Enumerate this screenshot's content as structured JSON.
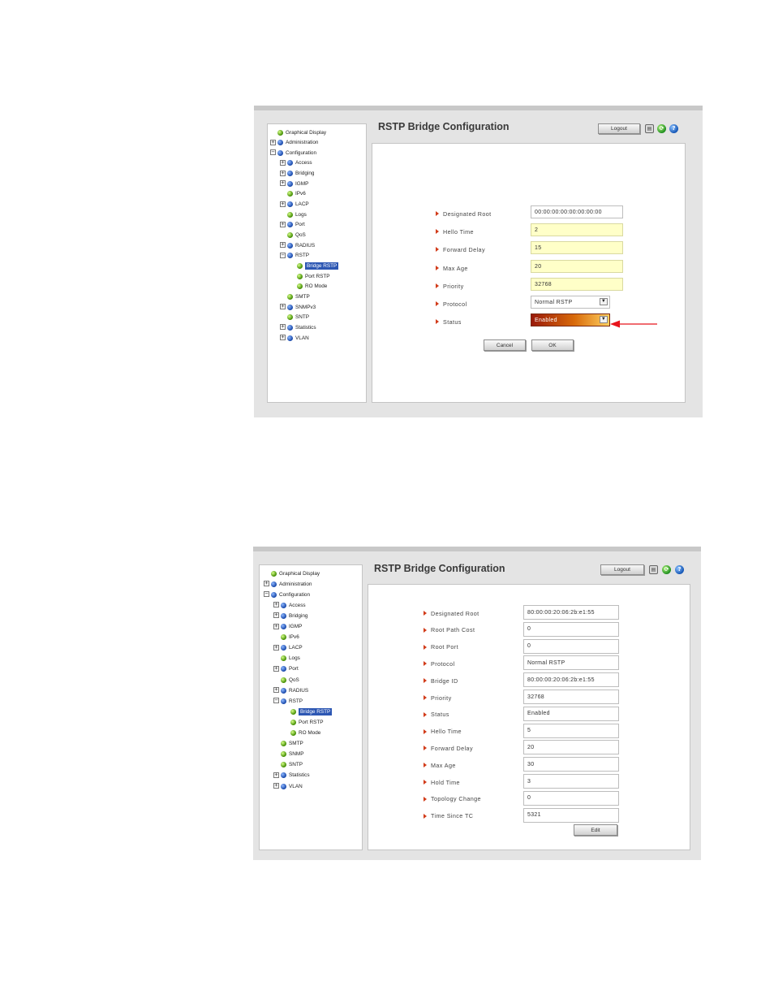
{
  "screen1": {
    "title": "RSTP Bridge Configuration",
    "logout_label": "Logout",
    "nav": [
      {
        "label": "Graphical Display",
        "icon": "green",
        "expander": ""
      },
      {
        "label": "Administration",
        "icon": "blue",
        "expander": "+"
      },
      {
        "label": "Configuration",
        "icon": "blue",
        "expander": "−"
      },
      {
        "label": "Access",
        "icon": "blue",
        "expander": "+"
      },
      {
        "label": "Bridging",
        "icon": "blue",
        "expander": "+"
      },
      {
        "label": "IGMP",
        "icon": "blue",
        "expander": "+"
      },
      {
        "label": "IPv6",
        "icon": "green",
        "expander": ""
      },
      {
        "label": "LACP",
        "icon": "blue",
        "expander": "+"
      },
      {
        "label": "Logs",
        "icon": "green",
        "expander": ""
      },
      {
        "label": "Port",
        "icon": "blue",
        "expander": "+"
      },
      {
        "label": "QoS",
        "icon": "green",
        "expander": ""
      },
      {
        "label": "RADIUS",
        "icon": "blue",
        "expander": "+"
      },
      {
        "label": "RSTP",
        "icon": "blue",
        "expander": "−"
      },
      {
        "label": "Bridge RSTP",
        "icon": "green",
        "expander": "",
        "selected": true
      },
      {
        "label": "Port RSTP",
        "icon": "green",
        "expander": ""
      },
      {
        "label": "RO Mode",
        "icon": "green",
        "expander": ""
      },
      {
        "label": "SMTP",
        "icon": "green",
        "expander": ""
      },
      {
        "label": "SNMPv3",
        "icon": "blue",
        "expander": "+"
      },
      {
        "label": "SNTP",
        "icon": "green",
        "expander": ""
      },
      {
        "label": "Statistics",
        "icon": "blue",
        "expander": "+"
      },
      {
        "label": "VLAN",
        "icon": "blue",
        "expander": "+"
      }
    ],
    "fields": [
      {
        "label": "Designated Root",
        "value": "00:00:00:00:00:00:00:00",
        "style": "plain"
      },
      {
        "label": "Hello Time",
        "value": "2",
        "style": "yellow"
      },
      {
        "label": "Forward Delay",
        "value": "15",
        "style": "yellow"
      },
      {
        "label": "Max Age",
        "value": "20",
        "style": "yellow"
      },
      {
        "label": "Priority",
        "value": "32768",
        "style": "yellow"
      },
      {
        "label": "Protocol",
        "value": "Normal RSTP",
        "style": "select"
      },
      {
        "label": "Status",
        "value": "Enabled",
        "style": "select enabled"
      }
    ],
    "cancel_label": "Cancel",
    "ok_label": "OK"
  },
  "screen2": {
    "title": "RSTP Bridge Configuration",
    "logout_label": "Logout",
    "nav": [
      {
        "label": "Graphical Display",
        "icon": "green",
        "expander": ""
      },
      {
        "label": "Administration",
        "icon": "blue",
        "expander": "+"
      },
      {
        "label": "Configuration",
        "icon": "blue",
        "expander": "−"
      },
      {
        "label": "Access",
        "icon": "blue",
        "expander": "+"
      },
      {
        "label": "Bridging",
        "icon": "blue",
        "expander": "+"
      },
      {
        "label": "IGMP",
        "icon": "blue",
        "expander": "+"
      },
      {
        "label": "IPv6",
        "icon": "green",
        "expander": ""
      },
      {
        "label": "LACP",
        "icon": "blue",
        "expander": "+"
      },
      {
        "label": "Logs",
        "icon": "green",
        "expander": ""
      },
      {
        "label": "Port",
        "icon": "blue",
        "expander": "+"
      },
      {
        "label": "QoS",
        "icon": "green",
        "expander": ""
      },
      {
        "label": "RADIUS",
        "icon": "blue",
        "expander": "+"
      },
      {
        "label": "RSTP",
        "icon": "blue",
        "expander": "−"
      },
      {
        "label": "Bridge RSTP",
        "icon": "green",
        "expander": "",
        "selected": true
      },
      {
        "label": "Port RSTP",
        "icon": "green",
        "expander": ""
      },
      {
        "label": "RO Mode",
        "icon": "green",
        "expander": ""
      },
      {
        "label": "SMTP",
        "icon": "green",
        "expander": ""
      },
      {
        "label": "SNMP",
        "icon": "green",
        "expander": ""
      },
      {
        "label": "SNTP",
        "icon": "green",
        "expander": ""
      },
      {
        "label": "Statistics",
        "icon": "blue",
        "expander": "+"
      },
      {
        "label": "VLAN",
        "icon": "blue",
        "expander": "+"
      }
    ],
    "fields": [
      {
        "label": "Designated Root",
        "value": "80:00:00:20:06:2b:e1:55"
      },
      {
        "label": "Root Path Cost",
        "value": "0"
      },
      {
        "label": "Root Port",
        "value": "0"
      },
      {
        "label": "Protocol",
        "value": "Normal RSTP"
      },
      {
        "label": "Bridge ID",
        "value": "80:00:00:20:06:2b:e1:55"
      },
      {
        "label": "Priority",
        "value": "32768"
      },
      {
        "label": "Status",
        "value": "Enabled"
      },
      {
        "label": "Hello Time",
        "value": "5"
      },
      {
        "label": "Forward Delay",
        "value": "20"
      },
      {
        "label": "Max Age",
        "value": "30"
      },
      {
        "label": "Hold Time",
        "value": "3"
      },
      {
        "label": "Topology Change",
        "value": "0"
      },
      {
        "label": "Time Since TC",
        "value": "5321"
      }
    ],
    "edit_label": "Edit"
  },
  "colors": {
    "bullet": "#d23c1a",
    "selected_nav": "#2d57b3",
    "annotation_arrow": "#e8141c"
  },
  "icons": [
    "save-icon",
    "refresh-icon",
    "help-icon",
    "red-arrow-annotation"
  ]
}
